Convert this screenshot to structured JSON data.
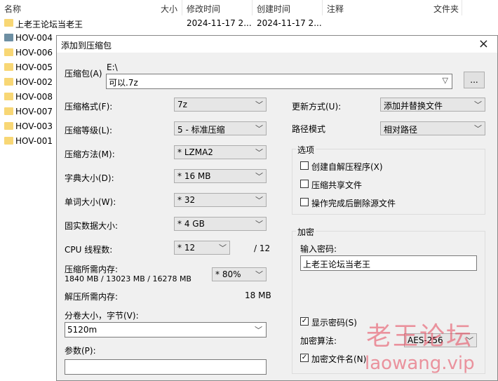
{
  "file_list": {
    "columns": [
      "名称",
      "大小",
      "修改时间",
      "创建时间",
      "注释",
      "文件夹"
    ],
    "rows": [
      {
        "name": "上老王论坛当老王",
        "modified": "2024-11-17 2...",
        "created": "2024-11-17 2...",
        "icon": "folder-icon"
      },
      {
        "name": "HOV-004",
        "modified": "",
        "created": "",
        "icon": "file-icon"
      },
      {
        "name": "HOV-006",
        "modified": "",
        "created": "",
        "icon": "folder-icon"
      },
      {
        "name": "HOV-005",
        "modified": "",
        "created": "",
        "icon": "folder-icon"
      },
      {
        "name": "HOV-002",
        "modified": "",
        "created": "",
        "icon": "folder-icon"
      },
      {
        "name": "HOV-008",
        "modified": "",
        "created": "",
        "icon": "folder-icon"
      },
      {
        "name": "HOV-007",
        "modified": "",
        "created": "",
        "icon": "folder-icon"
      },
      {
        "name": "HOV-003",
        "modified": "",
        "created": "",
        "icon": "folder-icon"
      },
      {
        "name": "HOV-001",
        "modified": "",
        "created": "",
        "icon": "folder-icon"
      }
    ]
  },
  "dialog": {
    "title": "添加到压缩包",
    "close_icon": "×",
    "archive": {
      "label": "压缩包(A)",
      "path": "E:\\",
      "value": "可以.7z",
      "browse": "..."
    },
    "format": {
      "label": "压缩格式(F):",
      "value": "7z"
    },
    "level": {
      "label": "压缩等级(L):",
      "value": "5 - 标准压缩"
    },
    "method": {
      "label": "压缩方法(M):",
      "value": "*  LZMA2"
    },
    "dict": {
      "label": "字典大小(D):",
      "value": "*  16 MB"
    },
    "word": {
      "label": "单词大小(W):",
      "value": "*  32"
    },
    "solid": {
      "label": "固实数据大小:",
      "value": "*  4 GB"
    },
    "cpu": {
      "label": "CPU 线程数:",
      "value": "*  12",
      "max": "/ 12"
    },
    "mem": {
      "label": "压缩所需内存:",
      "detail": "1840 MB / 13023 MB / 16278 MB",
      "value": "*  80%"
    },
    "decomp": {
      "label": "解压所需内存:",
      "value": "18 MB"
    },
    "volume": {
      "label": "分卷大小，字节(V):",
      "value": "5120m"
    },
    "params": {
      "label": "参数(P):",
      "value": ""
    },
    "update": {
      "label": "更新方式(U):",
      "value": "添加并替换文件"
    },
    "pathmode": {
      "label": "路径模式",
      "value": "相对路径"
    },
    "options": {
      "title": "选项",
      "items": [
        {
          "label": "创建自解压程序(X)",
          "checked": false
        },
        {
          "label": "压缩共享文件",
          "checked": false
        },
        {
          "label": "操作完成后删除源文件",
          "checked": false
        }
      ]
    },
    "encryption": {
      "title": "加密",
      "password_label": "输入密码:",
      "password_value": "上老王论坛当老王",
      "show_password": {
        "label": "显示密码(S)",
        "checked": true
      },
      "method_label": "加密算法:",
      "method_value": "AES-256",
      "encrypt_names": {
        "label": "加密文件名(N)",
        "checked": true
      }
    }
  },
  "watermark": {
    "line1": "老王论坛",
    "line2": "laowang.vip"
  },
  "colors": {
    "folder": "#f8d775",
    "file": "#6d8fa3",
    "selected_bg": "#ffffff"
  }
}
